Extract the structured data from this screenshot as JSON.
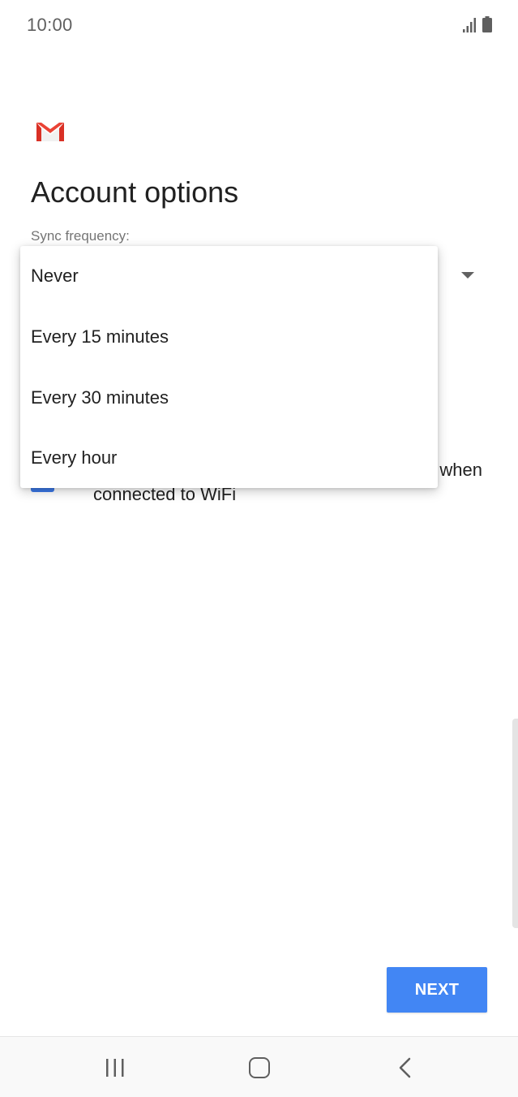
{
  "status_bar": {
    "time": "10:00",
    "icons": [
      "signal-icon",
      "battery-icon"
    ]
  },
  "app": {
    "logo_icon": "gmail-icon",
    "brand_colors": {
      "red": "#d93025",
      "light_red": "#ea4335",
      "gray": "#c5c5c5"
    }
  },
  "header": {
    "title": "Account options"
  },
  "sync": {
    "label": "Sync frequency:",
    "arrow_icon": "dropdown-arrow-icon"
  },
  "dropdown": {
    "options": [
      {
        "label": "Never"
      },
      {
        "label": "Every 15 minutes"
      },
      {
        "label": "Every 30 minutes"
      },
      {
        "label": "Every hour"
      }
    ]
  },
  "attachments_option": {
    "line1_visible": "when",
    "line2": "connected to WiFi",
    "checked": true,
    "color": "#3b78e7"
  },
  "footer": {
    "next_label": "NEXT",
    "button_color": "#4286f4"
  },
  "nav_bar": {
    "icons": [
      "recents-icon",
      "home-icon",
      "back-icon"
    ]
  }
}
